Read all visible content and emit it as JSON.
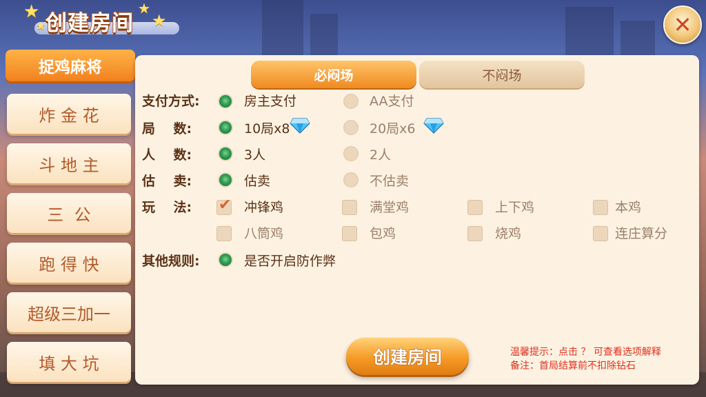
{
  "header": {
    "title": "创建房间",
    "close_icon": "close-icon"
  },
  "game_tabs": [
    {
      "label": "捉鸡麻将",
      "active": true
    },
    {
      "label": "炸 金 花",
      "active": false
    },
    {
      "label": "斗 地 主",
      "active": false
    },
    {
      "label": "三  公",
      "active": false
    },
    {
      "label": "跑 得 快",
      "active": false
    },
    {
      "label": "超级三加一",
      "active": false
    },
    {
      "label": "填 大 坑",
      "active": false
    }
  ],
  "mode_tabs": [
    {
      "label": "必闷场",
      "selected": true
    },
    {
      "label": "不闷场",
      "selected": false
    }
  ],
  "options": {
    "payment": {
      "label": "支付方式:",
      "choices": [
        "房主支付",
        "AA支付"
      ],
      "selected": "房主支付"
    },
    "rounds": {
      "label": "局    数:",
      "choices": [
        "10局x8",
        "20局x6"
      ],
      "selected": "10局x8",
      "cost_icon": "diamond-icon"
    },
    "players": {
      "label": "人    数:",
      "choices": [
        "3人",
        "2人"
      ],
      "selected": "3人"
    },
    "estimate": {
      "label": "估    卖:",
      "choices": [
        "估卖",
        "不估卖"
      ],
      "selected": "估卖"
    },
    "rules": {
      "label": "玩    法:",
      "checks": [
        {
          "label": "冲锋鸡",
          "checked": true
        },
        {
          "label": "满堂鸡",
          "checked": false
        },
        {
          "label": "上下鸡",
          "checked": false
        },
        {
          "label": "本鸡",
          "checked": false
        },
        {
          "label": "八筒鸡",
          "checked": false
        },
        {
          "label": "包鸡",
          "checked": false
        },
        {
          "label": "烧鸡",
          "checked": false
        },
        {
          "label": "连庄算分",
          "checked": false
        }
      ]
    },
    "other": {
      "label": "其他规则:",
      "choice": "是否开启防作弊",
      "selected": true
    }
  },
  "create_button": "创建房间",
  "tips": {
    "line1": "温馨提示：点击 ？ 可查看选项解释",
    "line2": "备注：首局结算前不扣除钻石"
  },
  "colors": {
    "accent_orange": "#f08a1f",
    "radio_on": "#2e9a54",
    "label_brown": "#5a3116",
    "tip_red": "#e0301e"
  }
}
